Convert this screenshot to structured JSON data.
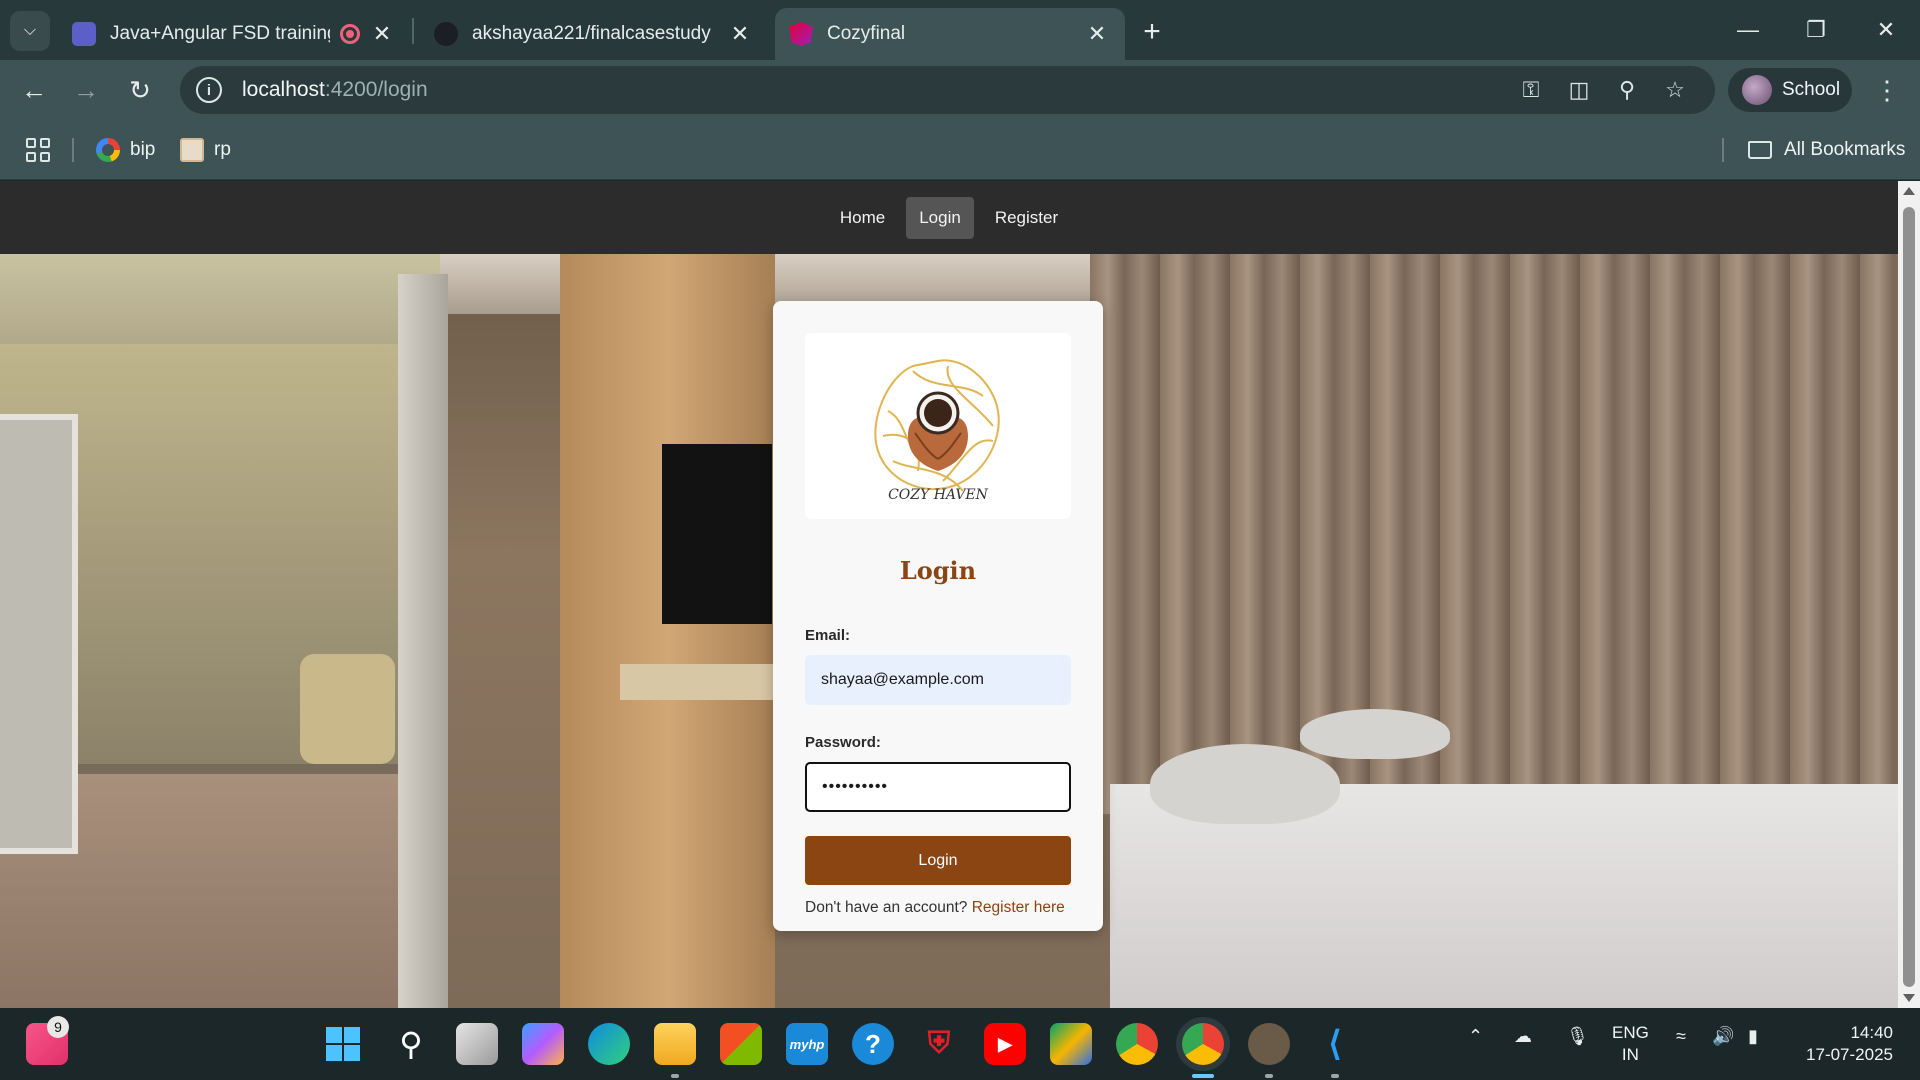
{
  "browser": {
    "tabs": [
      {
        "title": "Java+Angular FSD training",
        "active": false
      },
      {
        "title": "akshayaa221/finalcasestudy",
        "active": false
      },
      {
        "title": "Cozyfinal",
        "active": true
      }
    ],
    "url_host": "localhost",
    "url_path": ":4200/login",
    "profile_name": "School",
    "bookmarks": [
      {
        "label": "bip"
      },
      {
        "label": "rp"
      }
    ],
    "all_bookmarks": "All Bookmarks"
  },
  "site": {
    "nav": [
      {
        "label": "Home",
        "active": false
      },
      {
        "label": "Login",
        "active": true
      },
      {
        "label": "Register",
        "active": false
      }
    ],
    "logo_text": "COZY HAVEN",
    "form": {
      "title": "Login",
      "email_label": "Email:",
      "email_value": "shayaa@example.com",
      "password_label": "Password:",
      "password_value": "••••••••••",
      "submit_label": "Login",
      "register_prompt": "Don't have an account?",
      "register_link": "Register here"
    },
    "colors": {
      "brand": "#8b4513",
      "nav_bg": "#2c2c2c",
      "nav_active": "#555555"
    }
  },
  "taskbar": {
    "notification_count": "9",
    "language_line1": "ENG",
    "language_line2": "IN",
    "time": "14:40",
    "date": "17-07-2025"
  }
}
